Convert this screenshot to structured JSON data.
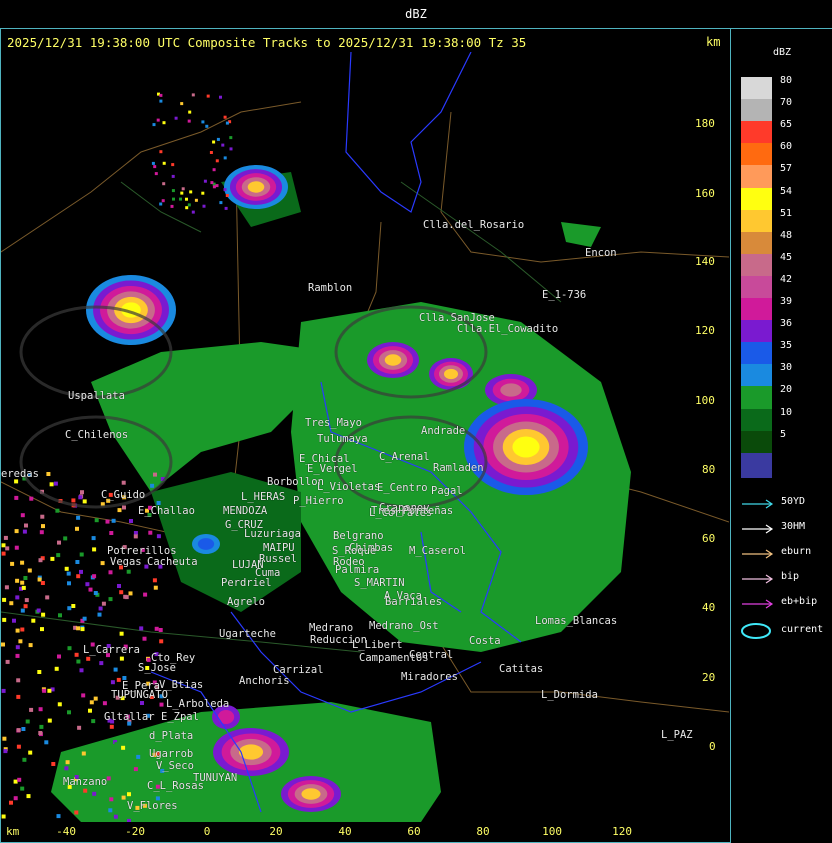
{
  "window_title": "dBZ",
  "header": {
    "text": "2025/12/31 19:38:00 UTC Composite Tracks to 2025/12/31 19:38:00 Tz 35",
    "km_label": "km"
  },
  "y_axis": {
    "ticks": [
      "180",
      "160",
      "140",
      "120",
      "100",
      "80",
      "60",
      "40",
      "20",
      "0"
    ]
  },
  "x_axis": {
    "km_label": "km",
    "ticks": [
      "-40",
      "-20",
      "0",
      "20",
      "40",
      "60",
      "80",
      "100",
      "120"
    ]
  },
  "legend": {
    "title": "dBZ",
    "levels": [
      {
        "label": "80",
        "color": "#d8d8d8"
      },
      {
        "label": "70",
        "color": "#b4b4b4"
      },
      {
        "label": "65",
        "color": "#ff3a2a"
      },
      {
        "label": "60",
        "color": "#ff6a10"
      },
      {
        "label": "57",
        "color": "#ff9a5a"
      },
      {
        "label": "54",
        "color": "#ffff10"
      },
      {
        "label": "51",
        "color": "#ffc830"
      },
      {
        "label": "48",
        "color": "#d88a3a"
      },
      {
        "label": "45",
        "color": "#c86a8a"
      },
      {
        "label": "42",
        "color": "#c84a9a"
      },
      {
        "label": "39",
        "color": "#d01a9a"
      },
      {
        "label": "36",
        "color": "#7a1ad0"
      },
      {
        "label": "35",
        "color": "#1a5ae8"
      },
      {
        "label": "30",
        "color": "#1a8ae0"
      },
      {
        "label": "20",
        "color": "#1a9a2a"
      },
      {
        "label": "10",
        "color": "#0a6a1a"
      },
      {
        "label": "5",
        "color": "#0a4a0a"
      },
      {
        "label": "",
        "color": "#3a3aa0"
      }
    ],
    "tracks": [
      {
        "label": "50YD",
        "color": "#40d8e8"
      },
      {
        "label": "30HM",
        "color": "#ffffff"
      },
      {
        "label": "eburn",
        "color": "#f0c080"
      },
      {
        "label": "bip",
        "color": "#f0c0e0"
      },
      {
        "label": "eb+bip",
        "color": "#e040e0"
      },
      {
        "label": "current",
        "color": "#40e8f8"
      }
    ]
  },
  "places": [
    {
      "name": "Clla.del_Rosario"
    },
    {
      "name": "Encon"
    },
    {
      "name": "E_1-736"
    },
    {
      "name": "Ramblon"
    },
    {
      "name": "Clla.SanJose"
    },
    {
      "name": "Clla.El_Cowadito"
    },
    {
      "name": "Uspallata"
    },
    {
      "name": "C_Chilenos"
    },
    {
      "name": "Tres_Mayo"
    },
    {
      "name": "Tulumaya"
    },
    {
      "name": "E_Chical"
    },
    {
      "name": "E_Vergel"
    },
    {
      "name": "Borbollon"
    },
    {
      "name": "L_Violetas"
    },
    {
      "name": "L_HERAS"
    },
    {
      "name": "P_Hierro"
    },
    {
      "name": "C_Guido"
    },
    {
      "name": "E_Challao"
    },
    {
      "name": "MENDOZA"
    },
    {
      "name": "G_CRUZ"
    },
    {
      "name": "Luzuriaga"
    },
    {
      "name": "MAIPU"
    },
    {
      "name": "Russel"
    },
    {
      "name": "Potrerillos"
    },
    {
      "name": "Cacheuta"
    },
    {
      "name": "Vegas"
    },
    {
      "name": "LUJAN"
    },
    {
      "name": "Cuma"
    },
    {
      "name": "Perdriel"
    },
    {
      "name": "Agrelo"
    },
    {
      "name": "Ugarteche"
    },
    {
      "name": "S_MARTIN"
    },
    {
      "name": "Palmira"
    },
    {
      "name": "Barriales"
    },
    {
      "name": "Medrano"
    },
    {
      "name": "Reduccion"
    },
    {
      "name": "L_Libert"
    },
    {
      "name": "Campamentos"
    },
    {
      "name": "Central"
    },
    {
      "name": "Carrizal"
    },
    {
      "name": "L_Carrera"
    },
    {
      "name": "Cto_Rey"
    },
    {
      "name": "S_Jose"
    },
    {
      "name": "E_Pera"
    },
    {
      "name": "TUPUNGATO"
    },
    {
      "name": "V_Btias"
    },
    {
      "name": "Anchoris"
    },
    {
      "name": "Gltallar"
    },
    {
      "name": "E_Zpal"
    },
    {
      "name": "L_Arboleda"
    },
    {
      "name": "d_Plata"
    },
    {
      "name": "Ugarrob"
    },
    {
      "name": "V_Seco"
    },
    {
      "name": "TUNUYAN"
    },
    {
      "name": "Manzano"
    },
    {
      "name": "C_L_Rosas"
    },
    {
      "name": "V_Flores"
    },
    {
      "name": "Miradores"
    },
    {
      "name": "Catitas"
    },
    {
      "name": "L_Dormida"
    },
    {
      "name": "Lomas_Blancas"
    },
    {
      "name": "L_PAZ"
    },
    {
      "name": "Crapanov"
    },
    {
      "name": "M_Caserol"
    },
    {
      "name": "Chimbas"
    },
    {
      "name": "E_Centro"
    },
    {
      "name": "L_Corrales"
    },
    {
      "name": "Andrade"
    },
    {
      "name": "C_Arenal"
    },
    {
      "name": "Ramladen"
    },
    {
      "name": "Rodeo"
    },
    {
      "name": "Belgrano"
    },
    {
      "name": "Medrano_Ost"
    },
    {
      "name": "Tres_Porteñas"
    },
    {
      "name": "Costa"
    },
    {
      "name": "eredas"
    },
    {
      "name": "A_Vaca"
    },
    {
      "name": "Pagal"
    },
    {
      "name": "S_Roque"
    }
  ]
}
